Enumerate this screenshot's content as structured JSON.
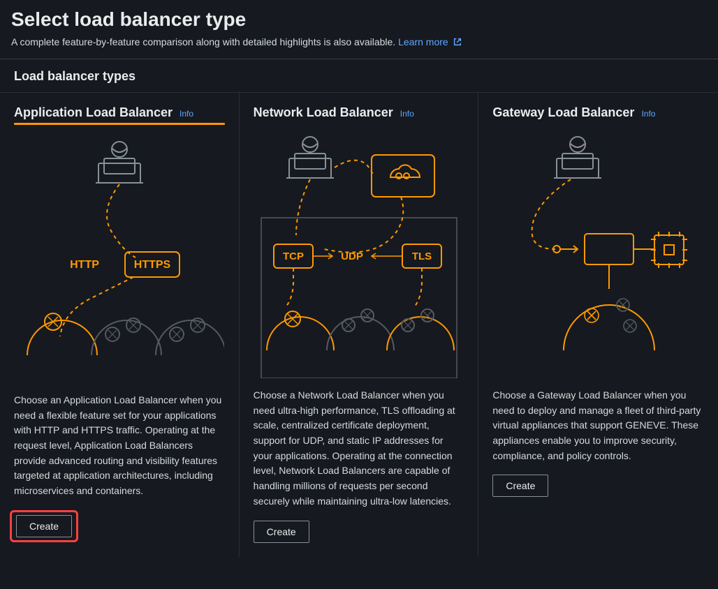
{
  "page": {
    "title": "Select load balancer type",
    "subtitle_text": "A complete feature-by-feature comparison along with detailed highlights is also available. ",
    "learn_more_label": "Learn more"
  },
  "section": {
    "title": "Load balancer types"
  },
  "cards": {
    "alb": {
      "title": "Application Load Balancer",
      "info": "Info",
      "protocol_http": "HTTP",
      "protocol_https": "HTTPS",
      "description": "Choose an Application Load Balancer when you need a flexible feature set for your applications with HTTP and HTTPS traffic. Operating at the request level, Application Load Balancers provide advanced routing and visibility features targeted at application architectures, including microservices and containers.",
      "create_label": "Create"
    },
    "nlb": {
      "title": "Network Load Balancer",
      "info": "Info",
      "protocol_tcp": "TCP",
      "protocol_udp": "UDP",
      "protocol_tls": "TLS",
      "description": "Choose a Network Load Balancer when you need ultra-high performance, TLS offloading at scale, centralized certificate deployment, support for UDP, and static IP addresses for your applications. Operating at the connection level, Network Load Balancers are capable of handling millions of requests per second securely while maintaining ultra-low latencies.",
      "create_label": "Create"
    },
    "glb": {
      "title": "Gateway Load Balancer",
      "info": "Info",
      "description": "Choose a Gateway Load Balancer when you need to deploy and manage a fleet of third-party virtual appliances that support GENEVE. These appliances enable you to improve security, compliance, and policy controls.",
      "create_label": "Create"
    }
  }
}
